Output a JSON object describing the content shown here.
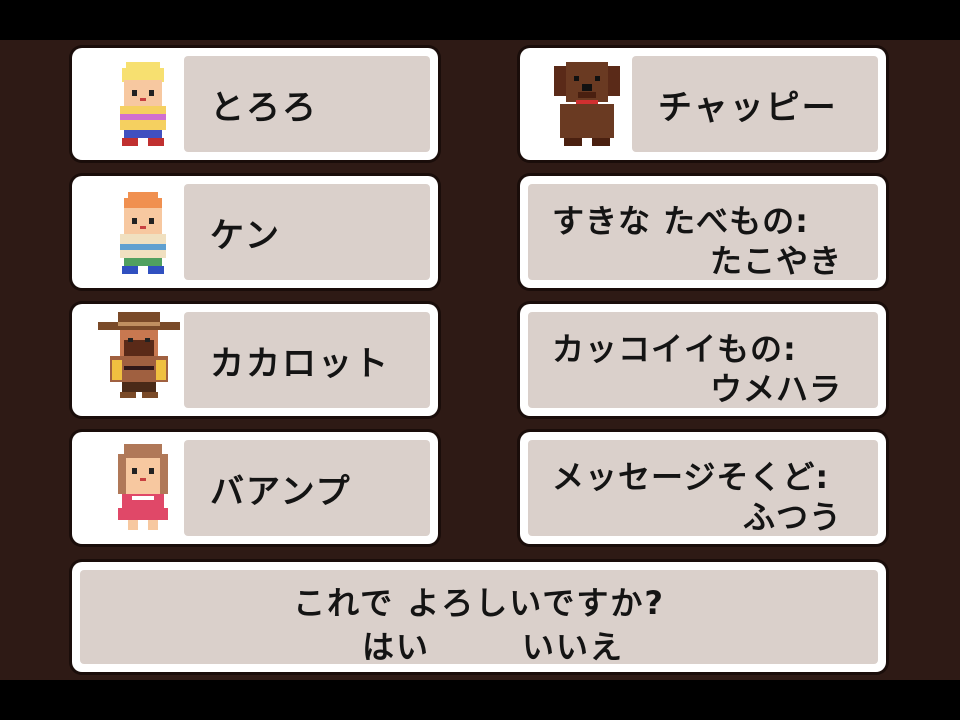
{
  "characters": [
    {
      "name": "とろろ",
      "portrait": "blond-boy-sprite-icon"
    },
    {
      "name": "ケン",
      "portrait": "orange-haired-boy-sprite-icon"
    },
    {
      "name": "カカロット",
      "portrait": "cowboy-sprite-icon"
    },
    {
      "name": "バアンプ",
      "portrait": "girl-pink-dress-sprite-icon"
    }
  ],
  "dog": {
    "name": "チャッピー",
    "portrait": "brown-dog-sprite-icon"
  },
  "settings": [
    {
      "label": "すきな たべもの:",
      "value": "たこやき"
    },
    {
      "label": "カッコイイもの:",
      "value": "ウメハラ"
    },
    {
      "label": "メッセージそくど:",
      "value": "ふつう"
    }
  ],
  "confirm": {
    "question": "これで よろしいですか?",
    "yes": "はい",
    "no": "いいえ"
  },
  "colors": {
    "background": "#2e1a15",
    "panel_border": "#ffffff",
    "panel_fill": "#dad0cb",
    "text": "#141414"
  }
}
